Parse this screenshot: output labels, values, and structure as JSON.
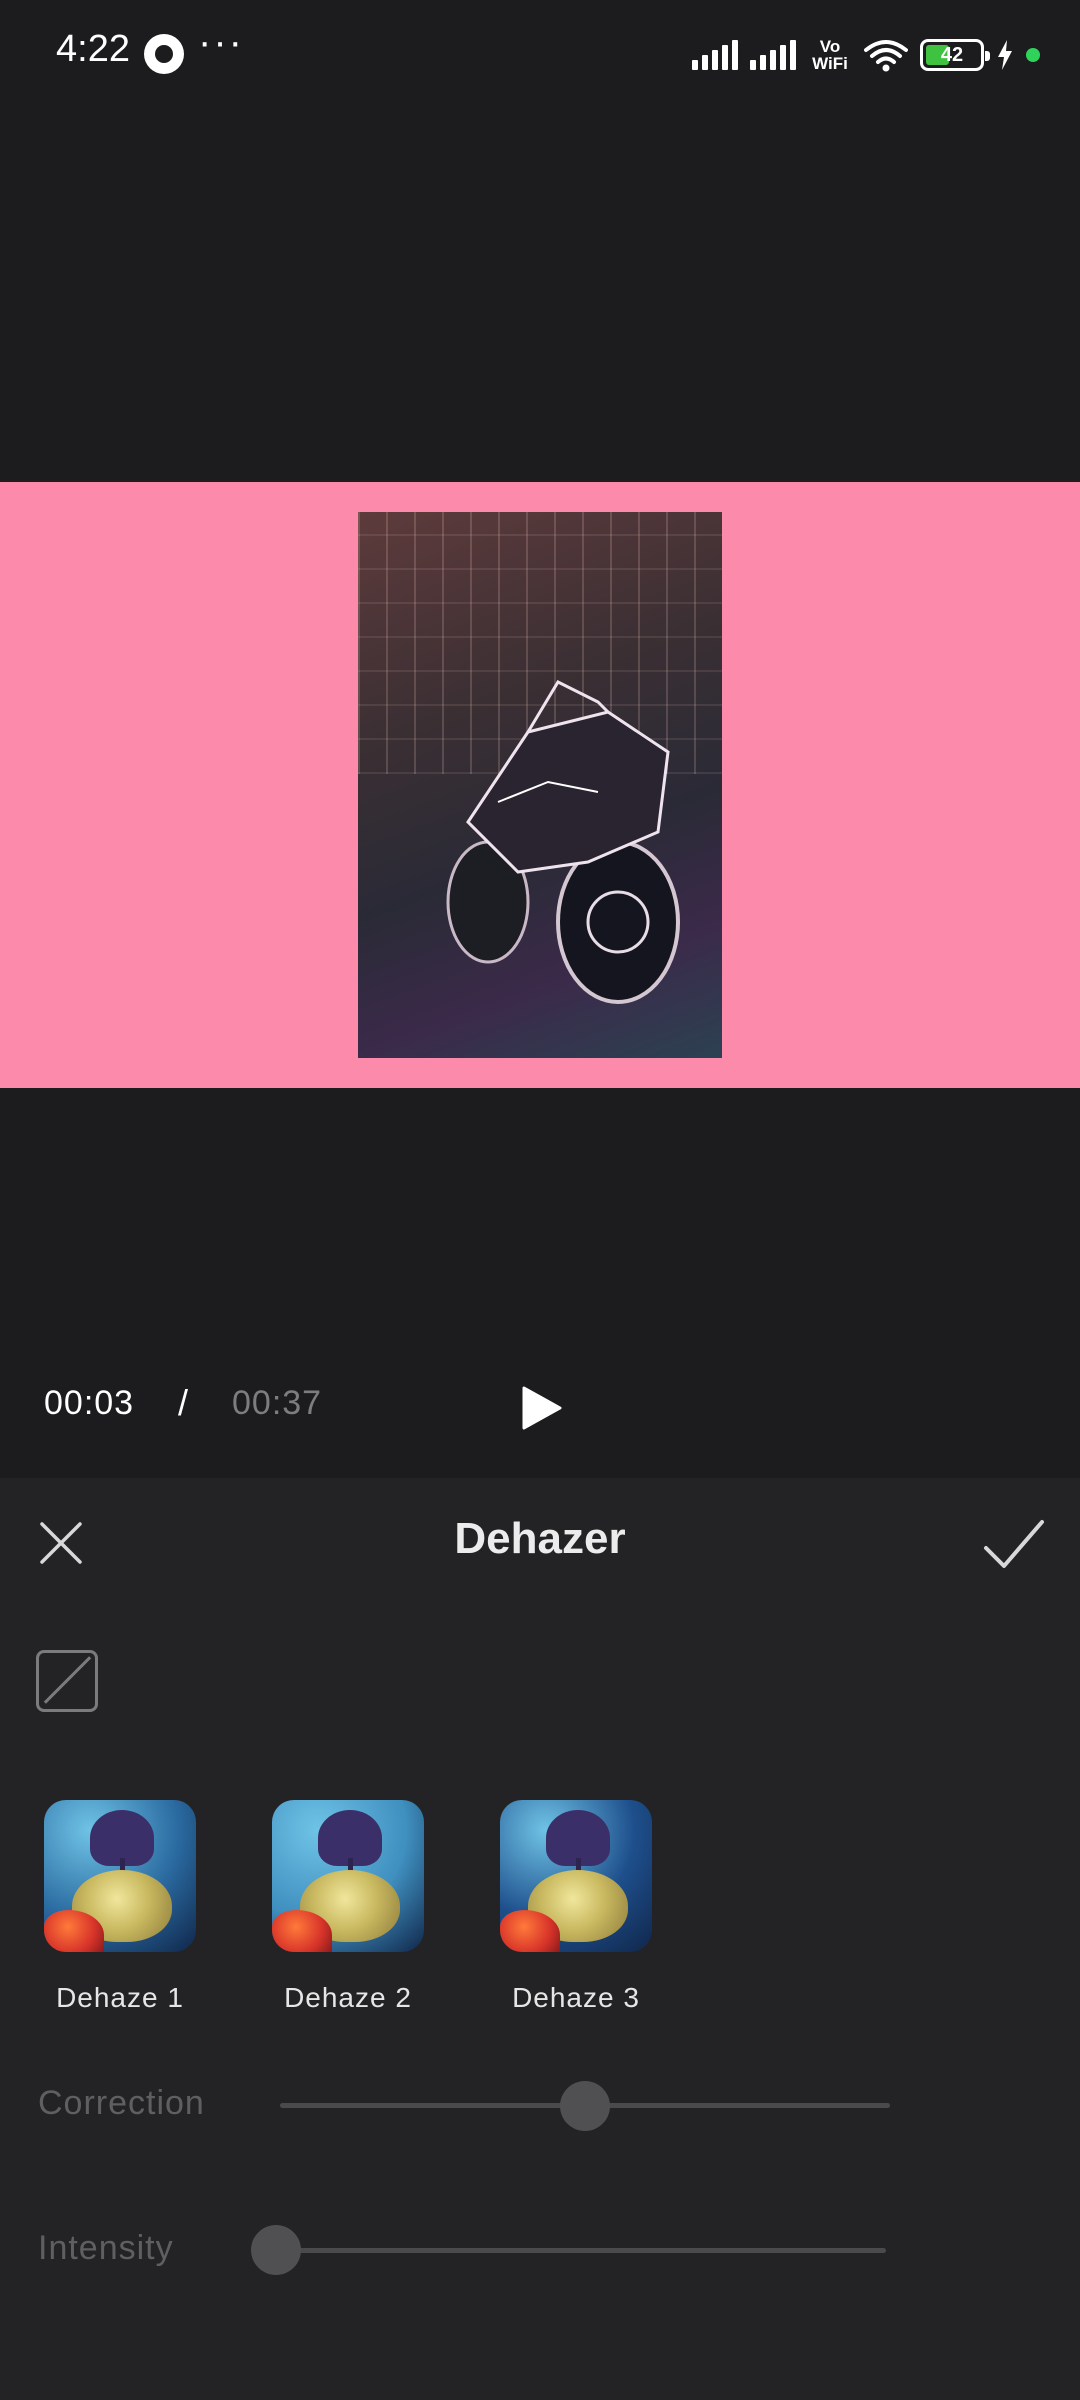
{
  "status_bar": {
    "time": "4:22",
    "more": "···",
    "network_label": "Vo WiFi",
    "battery_level": "42",
    "battery_fraction": 0.42,
    "icons": [
      "app-sync-icon",
      "more-icon",
      "signal-icon",
      "signal-icon",
      "vowifi-icon",
      "wifi-icon",
      "battery-icon",
      "charging-icon",
      "privacy-dot-icon"
    ]
  },
  "preview": {
    "background_color": "#fc8bab",
    "image_subject": "motorcycle-photo"
  },
  "playback": {
    "current_time": "00:03",
    "separator": "/",
    "total_time": "00:37",
    "play_icon": "play-icon"
  },
  "panel": {
    "title": "Dehazer",
    "close_icon": "close-icon",
    "confirm_icon": "checkmark-icon",
    "none_icon": "none-icon",
    "presets": [
      {
        "label": "Dehaze 1",
        "tint": "#2a6aa0"
      },
      {
        "label": "Dehaze 2",
        "tint": "#3f8fbf"
      },
      {
        "label": "Dehaze 3",
        "tint": "#1e4f8c"
      }
    ],
    "sliders": [
      {
        "label": "Correction",
        "value": 0.5
      },
      {
        "label": "Intensity",
        "value": 0.0
      }
    ]
  }
}
